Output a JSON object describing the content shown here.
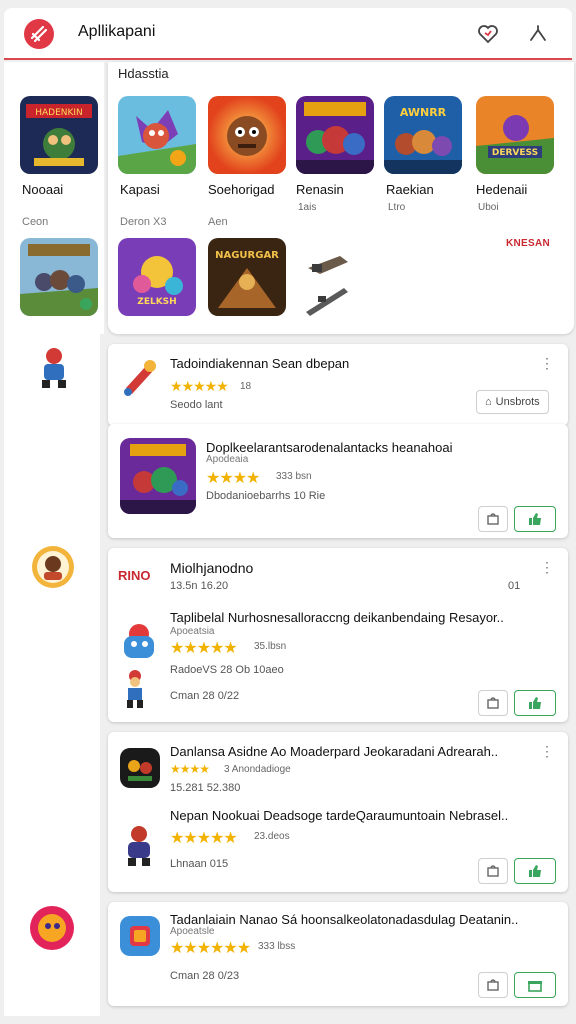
{
  "header": {
    "title": "Apllikapani"
  },
  "featured": {
    "section_label": "Hdasstia",
    "tiles": [
      {
        "name": "Nooaai"
      },
      {
        "name": "Kapasi"
      },
      {
        "name": "Soehorigad"
      },
      {
        "name": "Renasin",
        "sub": "1ais"
      },
      {
        "name": "Raekian",
        "sub": "Ltro"
      },
      {
        "name": "Hedenaii",
        "sub": "Uboi"
      }
    ],
    "row2_left_label": "Ceon",
    "row2_label_a": "Deron  X3",
    "row2_label_b": "Aen",
    "red_label": "KNESAN",
    "tile_texts": {
      "t1": "HADENKIN",
      "t5": "AWNRR",
      "t6": "DERVESS",
      "r2t2": "ZELKSH",
      "r2t3": "NAGURGAR"
    }
  },
  "cards": [
    {
      "title": "Tadoindiakennan Sean dbepan",
      "stars": "★★★★★",
      "rating": "18",
      "meta": "Seodo lant",
      "button_label": "Unsbrots"
    },
    {
      "title": "Doplkeelarantsarodenalantacks heanahoai",
      "developer": "Apodeaia",
      "stars": "★★★★",
      "rating": "333 bsn",
      "meta": "Dbodanioebarrhs 10 Rie"
    },
    {
      "title": "Miolhjanodno",
      "brand": "RINO",
      "meta_top": "13.5n 16.20",
      "badge": "01",
      "sub_title": "Taplibelal Nurhosnesalloraccng deikanbendaing Resayor..",
      "developer": "Apoeatsia",
      "stars": "★★★★★",
      "rating": "35.lbsn",
      "meta": "RadoeVS 28 Ob 10aeo",
      "meta2": "Cman 28 0/22"
    },
    {
      "title": "Danlansa Asidne Ao Moaderpard Jeokaradani Adrearah..",
      "stars": "★★★★",
      "rating": "3 Anondadioge",
      "meta_top": "15.281 52.380",
      "sub_title": "Nepan Nookuai Deadsoge tardeQaraumuntoain Nebrasel..",
      "stars2": "★★★★★",
      "rating2": "23.deos",
      "meta": "Lhnaan 015"
    },
    {
      "title": "Tadanlaiain Nanao Sá hoonsalkeolatonadasdulag Deatanin..",
      "developer": "Apoeatsle",
      "stars": "★★★★★★",
      "rating": "333 lbss",
      "meta": "Cman 28 0/23"
    }
  ],
  "colors": {
    "accent": "#e03845",
    "star": "#f2b200",
    "green": "#3aa55c"
  },
  "icons": [
    "brand-logo-icon",
    "heart-icon",
    "share-icon",
    "bag-icon",
    "thumb-up-icon",
    "kebab-icon"
  ]
}
